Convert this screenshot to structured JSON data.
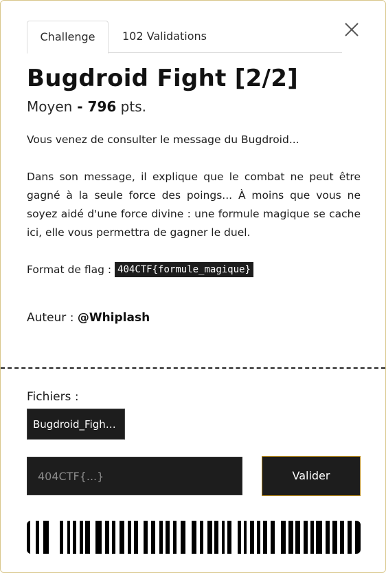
{
  "tabs": [
    {
      "label": "Challenge",
      "active": true
    },
    {
      "label": "102 Validations",
      "active": false
    }
  ],
  "close_icon": "close-icon",
  "challenge": {
    "title": "Bugdroid Fight [2/2]",
    "difficulty": "Moyen",
    "separator": " - ",
    "points": "796",
    "points_unit": " pts."
  },
  "description": {
    "p1": "Vous venez de consulter le message du Bugdroid...",
    "p2": "Dans son message, il explique que le combat ne peut être gagné à la seule force des poings... À moins que vous ne soyez aidé d'une force divine : une formule magique se cache ici, elle vous permettra de gagner le duel.",
    "flag_format_label": "Format de flag : ",
    "flag_format_value": "404CTF{formule_magique}"
  },
  "author": {
    "label": "Auteur : ",
    "name": "@Whiplash"
  },
  "files": {
    "label": "Fichiers :",
    "items": [
      "Bugdroid_Fight..."
    ]
  },
  "flag_input": {
    "value": "",
    "placeholder": "404CTF{...}"
  },
  "submit_label": "Valider",
  "colors": {
    "dark": "#1d1d1d",
    "accent_border": "#b88a1e",
    "modal_border": "#d8c68a"
  }
}
